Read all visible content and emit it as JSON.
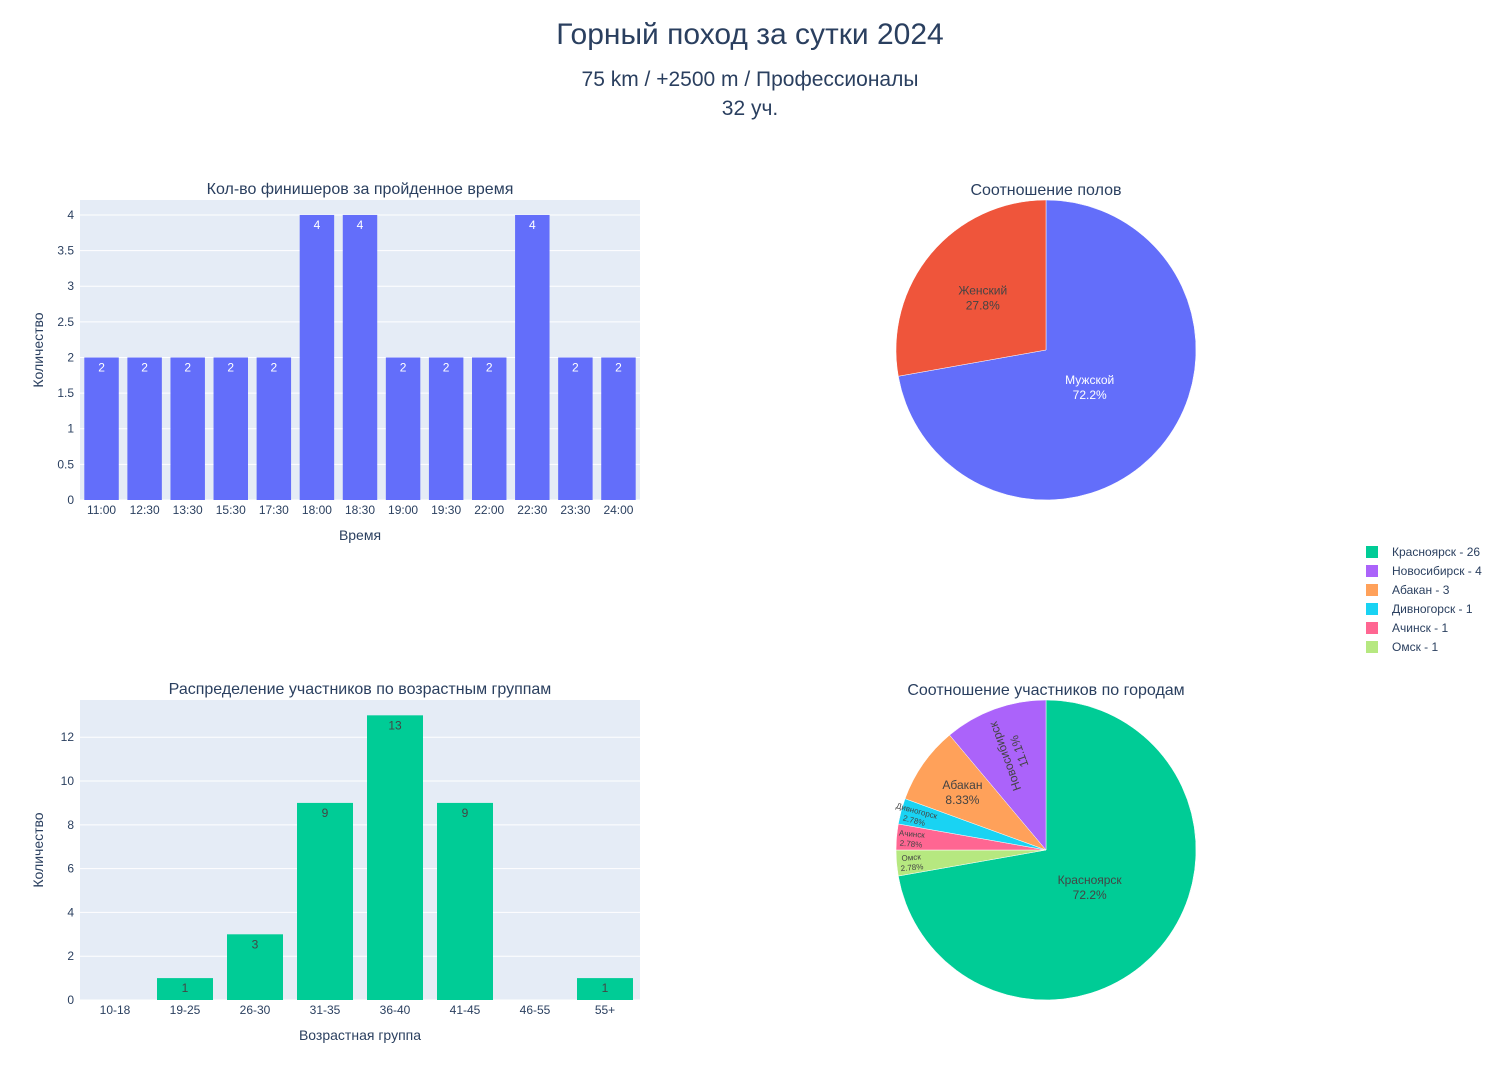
{
  "title": "Горный поход за сутки 2024",
  "subtitle_line1": "75 km / +2500 m / Профессионалы",
  "subtitle_line2": "32 уч.",
  "colors": {
    "bar_top": "#636efa",
    "bar_bottom": "#00cc96",
    "plot_bg": "#e5ecf6",
    "text": "#2a3f5f"
  },
  "chart_data": [
    {
      "type": "bar",
      "title": "Кол-во финишеров за пройденное время",
      "xlabel": "Время",
      "ylabel": "Количество",
      "categories": [
        "11:00",
        "12:30",
        "13:30",
        "15:30",
        "17:30",
        "18:00",
        "18:30",
        "19:00",
        "19:30",
        "22:00",
        "22:30",
        "23:30",
        "24:00"
      ],
      "values": [
        2,
        2,
        2,
        2,
        2,
        4,
        4,
        2,
        2,
        2,
        4,
        2,
        2
      ],
      "value_labels": [
        "2",
        "2",
        "2",
        "2",
        "2",
        "4",
        "4",
        "2",
        "2",
        "2",
        "4",
        "2",
        "2"
      ],
      "ylim": [
        0,
        4.21
      ],
      "yticks": [
        "0",
        "0.5",
        "1",
        "1.5",
        "2",
        "2.5",
        "3",
        "3.5",
        "4"
      ],
      "ytick_values": [
        0,
        0.5,
        1,
        1.5,
        2,
        2.5,
        3,
        3.5,
        4
      ],
      "grid": true,
      "color": "#636efa"
    },
    {
      "type": "pie",
      "title": "Соотношение полов",
      "labels": [
        "Мужской",
        "Женский"
      ],
      "values": [
        72.2,
        27.8
      ],
      "percent_labels": [
        "72.2%",
        "27.8%"
      ],
      "colors": [
        "#636efa",
        "#ef553b"
      ],
      "text_colors": [
        "#ffffff",
        "#444444"
      ]
    },
    {
      "type": "bar",
      "title": "Распределение участников по возрастным группам",
      "xlabel": "Возрастная группа",
      "ylabel": "Количество",
      "categories": [
        "10-18",
        "19-25",
        "26-30",
        "31-35",
        "36-40",
        "41-45",
        "46-55",
        "55+"
      ],
      "values": [
        0,
        1,
        3,
        9,
        13,
        9,
        0,
        1
      ],
      "value_labels": [
        "",
        "1",
        "3",
        "9",
        "13",
        "9",
        "",
        "1"
      ],
      "ylim": [
        0,
        13.7
      ],
      "yticks": [
        "0",
        "2",
        "4",
        "6",
        "8",
        "10",
        "12"
      ],
      "ytick_values": [
        0,
        2,
        4,
        6,
        8,
        10,
        12
      ],
      "grid": true,
      "color": "#00cc96"
    },
    {
      "type": "pie",
      "title": "Соотношение участников по городам",
      "labels": [
        "Красноярск",
        "Омск",
        "Ачинск",
        "Дивногорск",
        "Абакан",
        "Новосибирск"
      ],
      "values": [
        26,
        1,
        1,
        1,
        3,
        4
      ],
      "percent_labels": [
        "72.2%",
        "2.78%",
        "2.78%",
        "2.78%",
        "8.33%",
        "11.1%"
      ],
      "colors": [
        "#00cc96",
        "#b6e880",
        "#ff6692",
        "#19d3f3",
        "#ffa15a",
        "#ab63fa"
      ],
      "legend": {
        "placement": "right",
        "entries": [
          "Красноярск - 26",
          "Новосибирск - 4",
          "Абакан - 3",
          "Дивногорск - 1",
          "Ачинск - 1",
          "Омск - 1"
        ],
        "colors": [
          "#00cc96",
          "#ab63fa",
          "#ffa15a",
          "#19d3f3",
          "#ff6692",
          "#b6e880"
        ]
      }
    }
  ]
}
